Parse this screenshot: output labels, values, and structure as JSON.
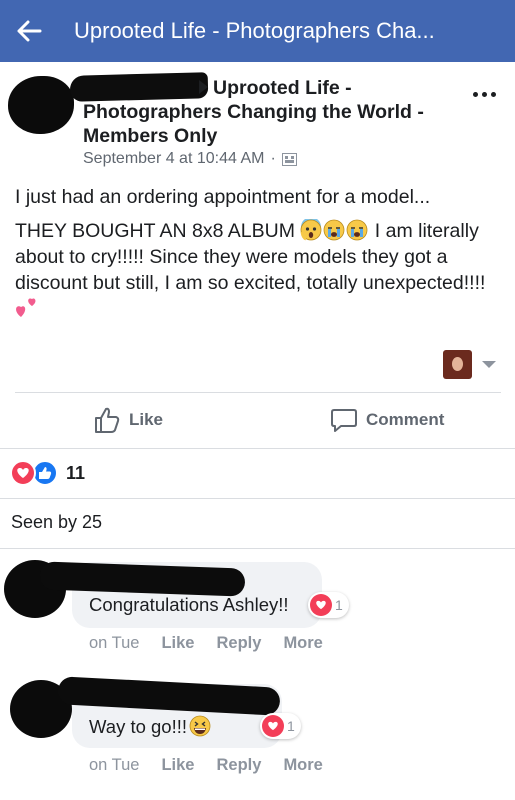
{
  "header": {
    "title": "Uprooted Life - Photographers Cha..."
  },
  "post": {
    "group_line1": "Uprooted Life -",
    "group_line2": "Photographers Changing the World -",
    "group_line3": "Members Only",
    "timestamp": "September 4 at 10:44 AM",
    "separator": "·",
    "body_line1": "I just had an ordering appointment for a model...",
    "body_line2a": "THEY BOUGHT AN 8x8 ALBUM ",
    "body_line2b": " I am literally",
    "body_line3": "about to cry!!!!! Since they were models they got a",
    "body_line4": "discount but still, I am so excited, totally unexpected!!!!",
    "emojis": [
      "scream-emoji",
      "crying-emoji",
      "crying-emoji"
    ]
  },
  "actions": {
    "like_label": "Like",
    "comment_label": "Comment"
  },
  "reactions": {
    "count": "11",
    "types": [
      "love",
      "like"
    ]
  },
  "seen_by": "Seen by 25",
  "comments": [
    {
      "text": "Congratulations Ashley!!",
      "reaction_count": "1",
      "time": "on Tue",
      "like": "Like",
      "reply": "Reply",
      "more": "More"
    },
    {
      "text": "Way to go!!!",
      "reaction_count": "1",
      "time": "on Tue",
      "like": "Like",
      "reply": "Reply",
      "more": "More"
    }
  ],
  "colors": {
    "header_bg": "#4267b2",
    "love": "#f33e58",
    "like": "#1877f2",
    "muted_text": "#606770"
  }
}
